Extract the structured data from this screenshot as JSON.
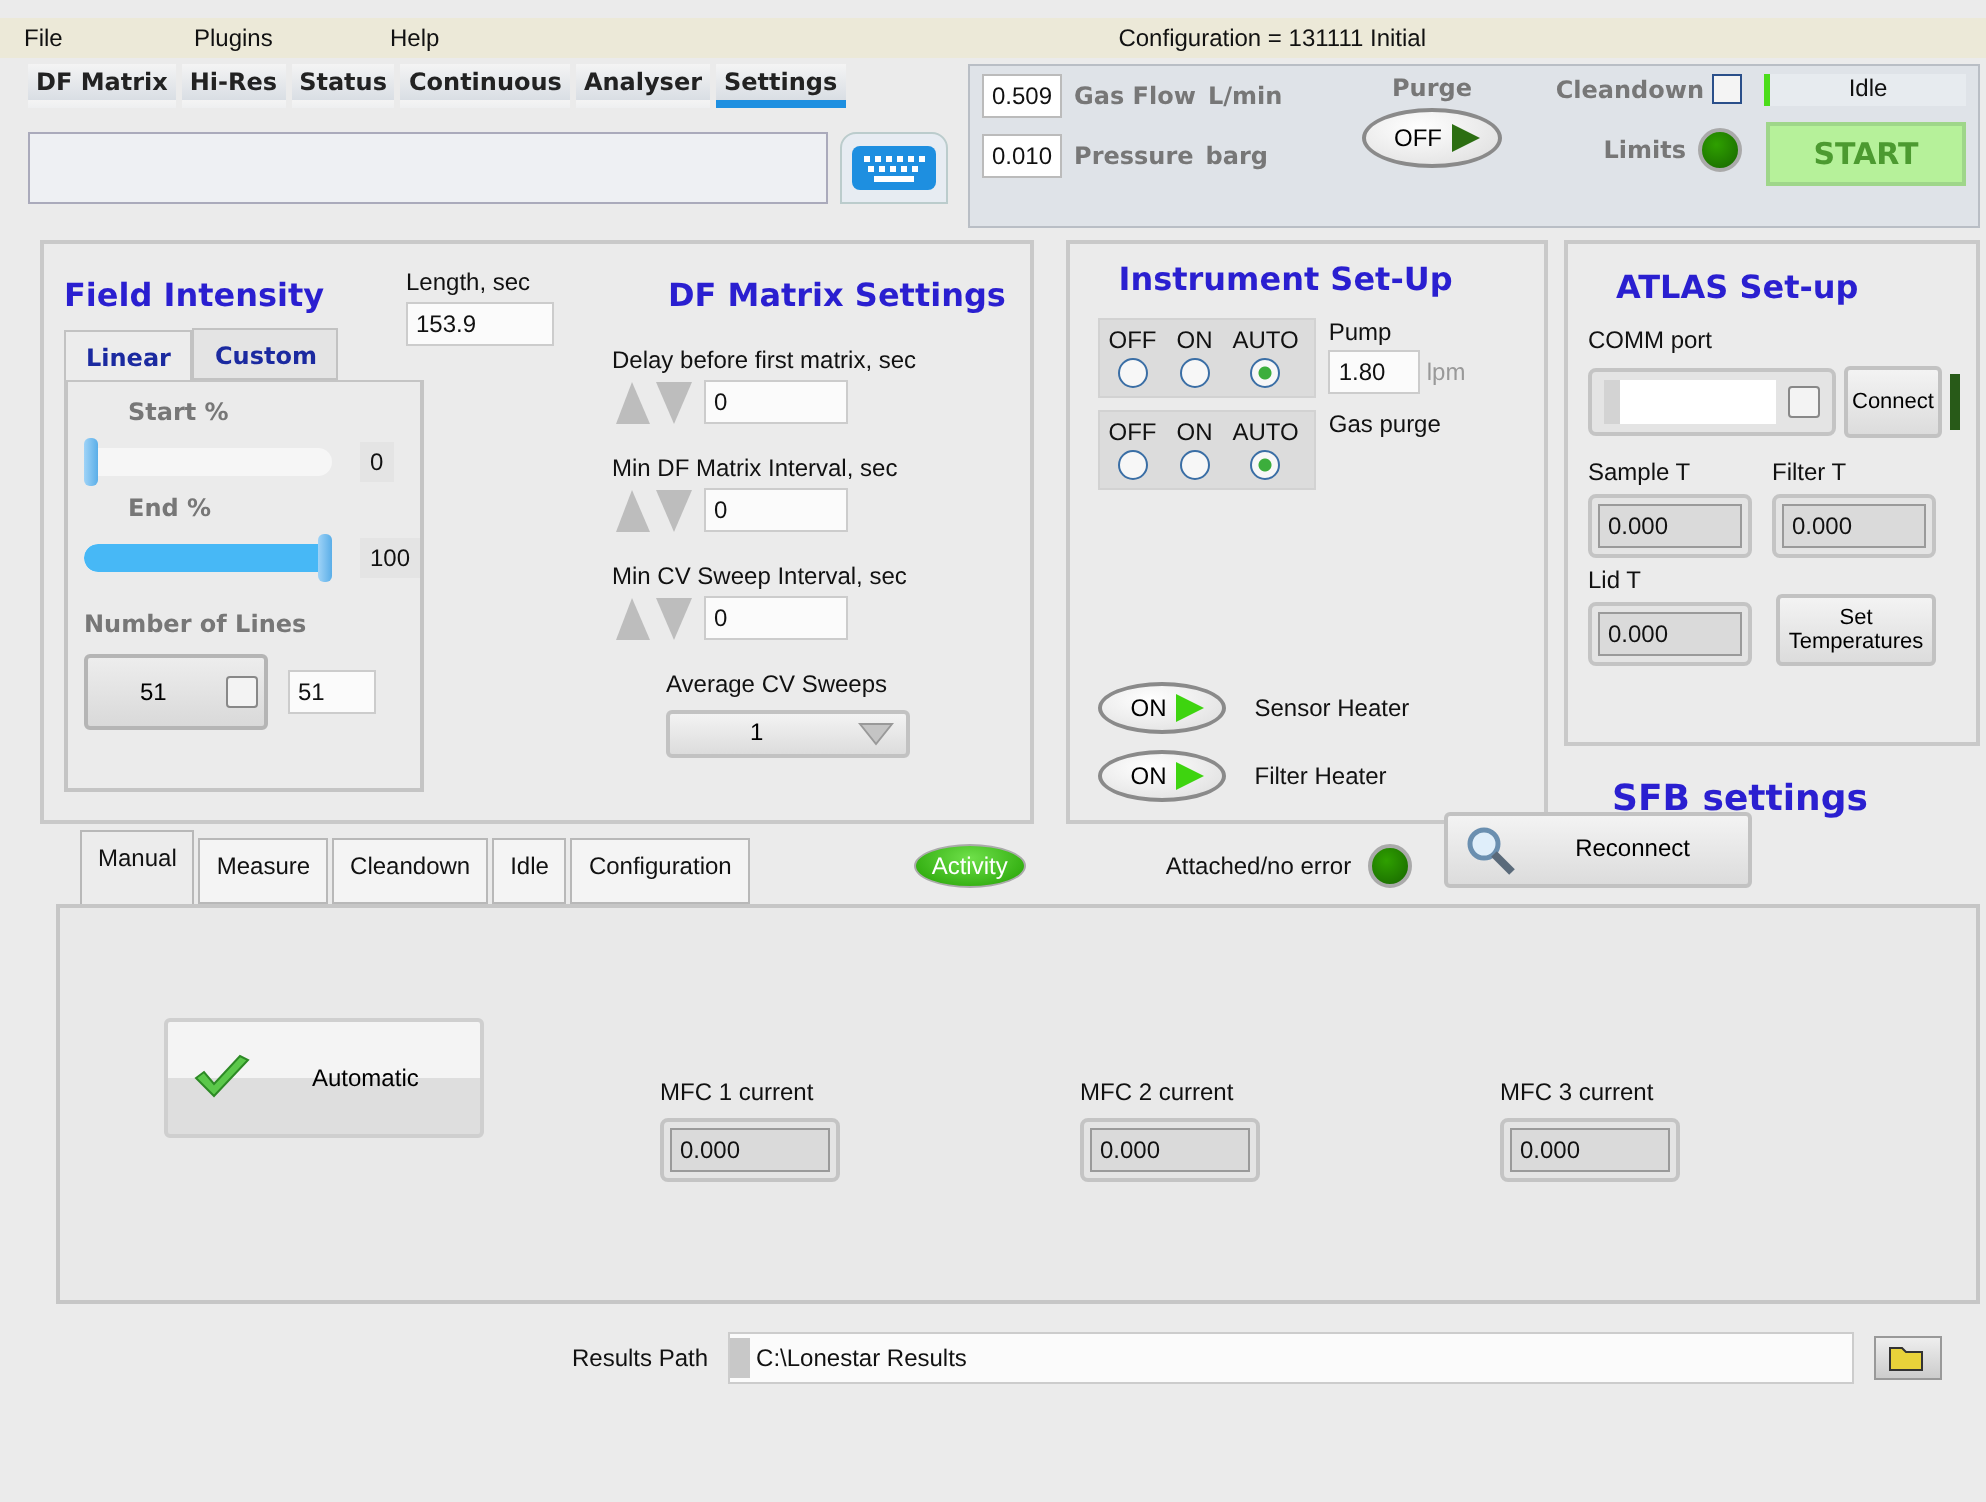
{
  "menu": [
    "File",
    "Plugins",
    "Help"
  ],
  "configuration": "Configuration = 131111 Initial",
  "view_tabs": [
    {
      "label": "DF Matrix",
      "selected": false
    },
    {
      "label": "Hi-Res",
      "selected": false
    },
    {
      "label": "Status",
      "selected": false
    },
    {
      "label": "Continuous",
      "selected": false
    },
    {
      "label": "Analyser",
      "selected": false
    },
    {
      "label": "Settings",
      "selected": true
    }
  ],
  "readings": [
    {
      "value": "0.509",
      "label": "Gas Flow",
      "unit": "L/min"
    },
    {
      "value": "0.010",
      "label": "Pressure",
      "unit": "barg"
    }
  ],
  "purge": {
    "label": "Purge",
    "switch": "OFF",
    "on": false
  },
  "cleandown": {
    "label": "Cleandown",
    "checked": false
  },
  "limits": {
    "label": "Limits",
    "on": true
  },
  "status": {
    "text": "Idle"
  },
  "start_button": {
    "label": "START",
    "disabled": true
  },
  "field_intensity": {
    "title": "Field Intensity",
    "length_label": "Length, sec",
    "length_value": "153.9",
    "tabs": [
      {
        "label": "Linear",
        "selected": true
      },
      {
        "label": "Custom",
        "selected": false
      }
    ],
    "sliders": [
      {
        "label": "Start %",
        "level": 0,
        "value": "0"
      },
      {
        "label": "End %",
        "level": 1,
        "value": "100"
      }
    ],
    "lines_label": "Number of Lines",
    "lines_select": "51",
    "lines_value": "51"
  },
  "df_matrix": {
    "title": "DF Matrix Settings",
    "fields": [
      {
        "label": "Delay before first matrix, sec",
        "value": "0"
      },
      {
        "label": "Min DF Matrix Interval, sec",
        "value": "0"
      },
      {
        "label": "Min CV Sweep Interval, sec",
        "value": "0"
      }
    ],
    "average_label": "Average CV Sweeps",
    "average_value": "1"
  },
  "instrument": {
    "title": "Instrument Set-Up",
    "radio_groups": [
      {
        "options": [
          {
            "label": "OFF",
            "selected": false
          },
          {
            "label": "ON",
            "selected": false
          },
          {
            "label": "AUTO",
            "selected": true
          }
        ],
        "label": "Pump",
        "value": "1.80",
        "unit": "lpm"
      },
      {
        "options": [
          {
            "label": "OFF",
            "selected": false
          },
          {
            "label": "ON",
            "selected": false
          },
          {
            "label": "AUTO",
            "selected": true
          }
        ],
        "label": "Gas purge"
      }
    ],
    "heaters": [
      {
        "switch": "ON",
        "on": true,
        "label": "Sensor Heater"
      },
      {
        "switch": "ON",
        "on": true,
        "label": "Filter Heater"
      }
    ]
  },
  "atlas": {
    "title": "ATLAS Set-up",
    "comm_label": "COMM port",
    "connect": "Connect",
    "connected": false,
    "temps": [
      {
        "label": "Sample T",
        "value": "0.000"
      },
      {
        "label": "Filter T",
        "value": "0.000"
      },
      {
        "label": "Lid T",
        "value": "0.000"
      }
    ],
    "set_button": "Set Temperatures"
  },
  "sfb": {
    "title": "SFB settings",
    "tabs": [
      {
        "label": "Manual",
        "selected": true
      },
      {
        "label": "Measure",
        "selected": false
      },
      {
        "label": "Cleandown",
        "selected": false
      },
      {
        "label": "Idle",
        "selected": false
      },
      {
        "label": "Configuration",
        "selected": false
      }
    ],
    "activity": "Activity",
    "attached_label": "Attached/no error",
    "attached_on": true,
    "reconnect": "Reconnect",
    "automatic": "Automatic",
    "mfcs": [
      {
        "label": "MFC 1 current",
        "value": "0.000"
      },
      {
        "label": "MFC 2 current",
        "value": "0.000"
      },
      {
        "label": "MFC 3 current",
        "value": "0.000"
      }
    ]
  },
  "results": {
    "label": "Results Path",
    "value": "C:\\Lonestar Results"
  }
}
